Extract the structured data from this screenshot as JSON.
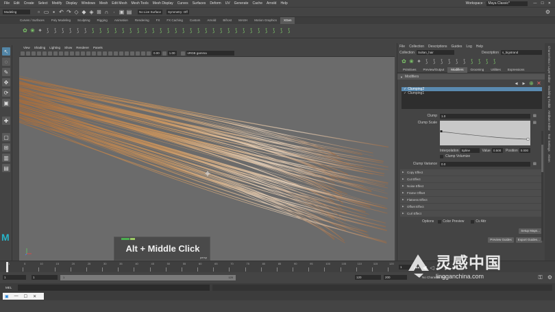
{
  "menubar": {
    "items": [
      "File",
      "Edit",
      "Create",
      "Select",
      "Modify",
      "Display",
      "Windows",
      "Mesh",
      "Edit Mesh",
      "Mesh Tools",
      "Mesh Display",
      "Curves",
      "Surfaces",
      "Deform",
      "UV",
      "Generate",
      "Cache",
      "Arnold",
      "Help"
    ],
    "workspace_label": "Workspace :",
    "workspace_value": "Maya Classic*"
  },
  "statusline": {
    "mode": "Modeling",
    "live_surface": "No Live Surface",
    "symmetry": "Symmetry: Off"
  },
  "shelf": {
    "tabs": [
      "Curves / Surfaces",
      "Poly Modeling",
      "Sculpting",
      "Rigging",
      "Animation",
      "Rendering",
      "FX",
      "FX Caching",
      "Custom",
      "Arnold",
      "Bifrost",
      "MASH",
      "Motion Graphics",
      "XGen"
    ],
    "active_tab": "XGen"
  },
  "viewport": {
    "menu": [
      "View",
      "Shading",
      "Lighting",
      "Show",
      "Renderer",
      "Panels"
    ],
    "value_a": "0.00",
    "value_b": "1.00",
    "color_space": "sRGB gamma",
    "overlay_text": "Alt + Middle Click",
    "camera_label": "persp",
    "hair_color": "#b8865a"
  },
  "xgen": {
    "menu": [
      "File",
      "Collection",
      "Descriptions",
      "Guides",
      "Log",
      "Help"
    ],
    "collection_label": "Collection",
    "collection_value": "Sultan_hair",
    "description_label": "Description",
    "description_value": "s_bigstrand",
    "tabs": [
      "Primitives",
      "Preview/Output",
      "Modifiers",
      "Grooming",
      "Utilities",
      "Expressions"
    ],
    "active_tab": "Modifiers",
    "section_title": "Modifiers",
    "modifiers": [
      "Clumping2",
      "Clumping1"
    ],
    "clump_label": "Clump",
    "clump_value": "1.0",
    "clump_scale_label": "Clump Scale",
    "interp_label": "Interpolation",
    "interp_value": "Spline",
    "value_label": "Value",
    "value_value": "0.500",
    "position_label": "Position",
    "position_value": "0.000",
    "clump_volumize": "Clump Volumize",
    "clump_variance_label": "Clump Variance",
    "clump_variance_value": "0.0",
    "effects": [
      "Copy Effect",
      "Cut Effect",
      "Noise Effect",
      "Frame Offset",
      "Flatness Effect",
      "Offset Effect",
      "Curl Effect"
    ],
    "options_label": "Options",
    "color_preview": "Color Preview",
    "cv_attr": "Cv Attr",
    "setup_maps": "Setup Maps...",
    "preview_guides": "Preview Guides",
    "export_guides": "Export Guides..."
  },
  "sidetabs": [
    "Channel Box / Layer Editor",
    "Modeling Toolkit",
    "Attribute Editor",
    "Tool Settings",
    "XGen"
  ],
  "timeline": {
    "ticks": [
      "1",
      "5",
      "10",
      "15",
      "20",
      "25",
      "30",
      "35",
      "40",
      "45",
      "50",
      "55",
      "60",
      "65",
      "70",
      "75",
      "80",
      "85",
      "90",
      "95",
      "100",
      "105",
      "110",
      "115",
      "120"
    ],
    "current_frame": "1"
  },
  "range": {
    "start": "1",
    "playback_start": "1",
    "slider_start": "1",
    "slider_end": "120",
    "end": "120",
    "anim_end": "200",
    "character_set": "No Character Set"
  },
  "cmdline": {
    "label": "MEL"
  },
  "watermark": {
    "brand_cn": "灵感中国",
    "url": "lingganchina.com"
  }
}
